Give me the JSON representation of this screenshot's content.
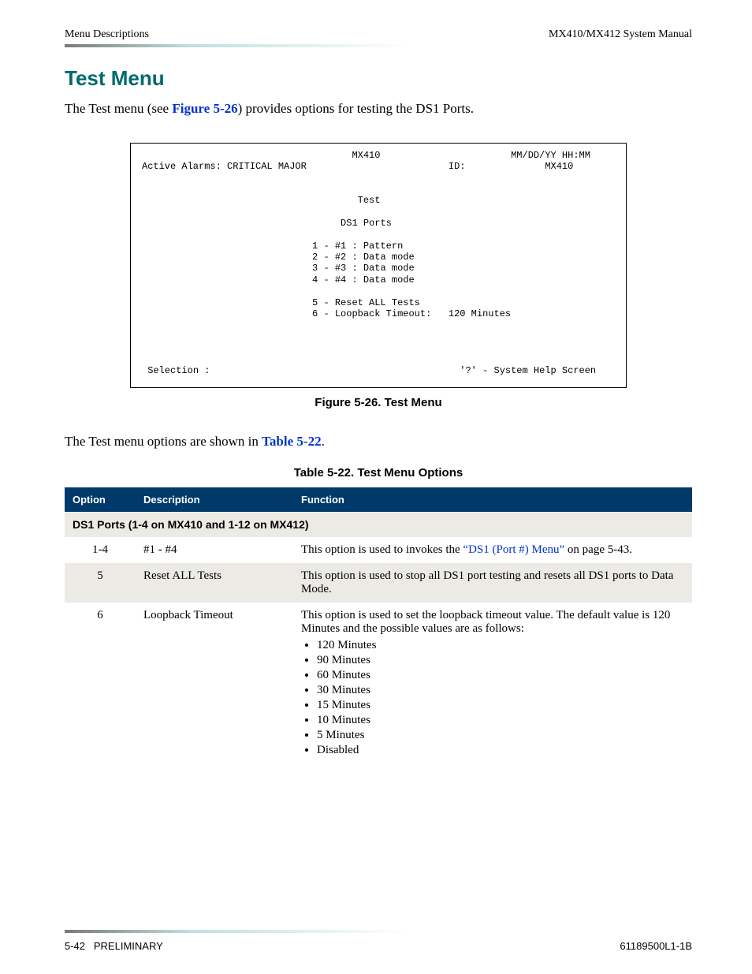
{
  "header": {
    "left": "Menu Descriptions",
    "right": "MX410/MX412 System Manual"
  },
  "section_title": "Test Menu",
  "intro": {
    "before_ref": "The Test menu (see ",
    "ref": "Figure 5-26",
    "after_ref": ") provides options for testing the DS1 Ports."
  },
  "terminal": {
    "title_center": "MX410",
    "date": "MM/DD/YY HH:MM",
    "alarms": "Active Alarms: CRITICAL MAJOR",
    "id_label": "ID:",
    "id_value": "MX410",
    "screen_title": "Test",
    "section": "DS1 Ports",
    "items": [
      "1 - #1 : Pattern",
      "2 - #2 : Data mode",
      "3 - #3 : Data mode",
      "4 - #4 : Data mode"
    ],
    "extra": [
      "5 - Reset ALL Tests",
      "6 - Loopback Timeout:   120 Minutes"
    ],
    "prompt": "Selection :",
    "help": "'?' - System Help Screen"
  },
  "figure_caption": "Figure 5-26.  Test Menu",
  "para2": {
    "before_ref": "The Test menu options are shown in ",
    "ref": "Table 5-22",
    "after_ref": "."
  },
  "table_caption": "Table 5-22.  Test Menu Options",
  "table": {
    "headers": {
      "opt": "Option",
      "desc": "Description",
      "func": "Function"
    },
    "subhead": "DS1 Ports (1-4 on MX410 and 1-12 on MX412)",
    "rows": [
      {
        "opt": "1-4",
        "desc": "#1 - #4",
        "func_before": "This option is used to invokes the ",
        "func_ref": "“DS1 (Port #) Menu”",
        "func_after": " on page 5-43."
      },
      {
        "opt": "5",
        "desc": "Reset ALL Tests",
        "func": "This option is used to stop all DS1 port testing and resets all DS1 ports to Data Mode."
      },
      {
        "opt": "6",
        "desc": "Loopback Timeout",
        "func": "This option is used to set the loopback timeout value. The default value is 120 Minutes and the possible values are as follows:",
        "values": [
          "120 Minutes",
          "90 Minutes",
          "60 Minutes",
          "30 Minutes",
          "15 Minutes",
          "10 Minutes",
          "5 Minutes",
          "Disabled"
        ]
      }
    ]
  },
  "footer": {
    "left_page": "5-42",
    "left_status": "PRELIMINARY",
    "right": "61189500L1-1B"
  }
}
